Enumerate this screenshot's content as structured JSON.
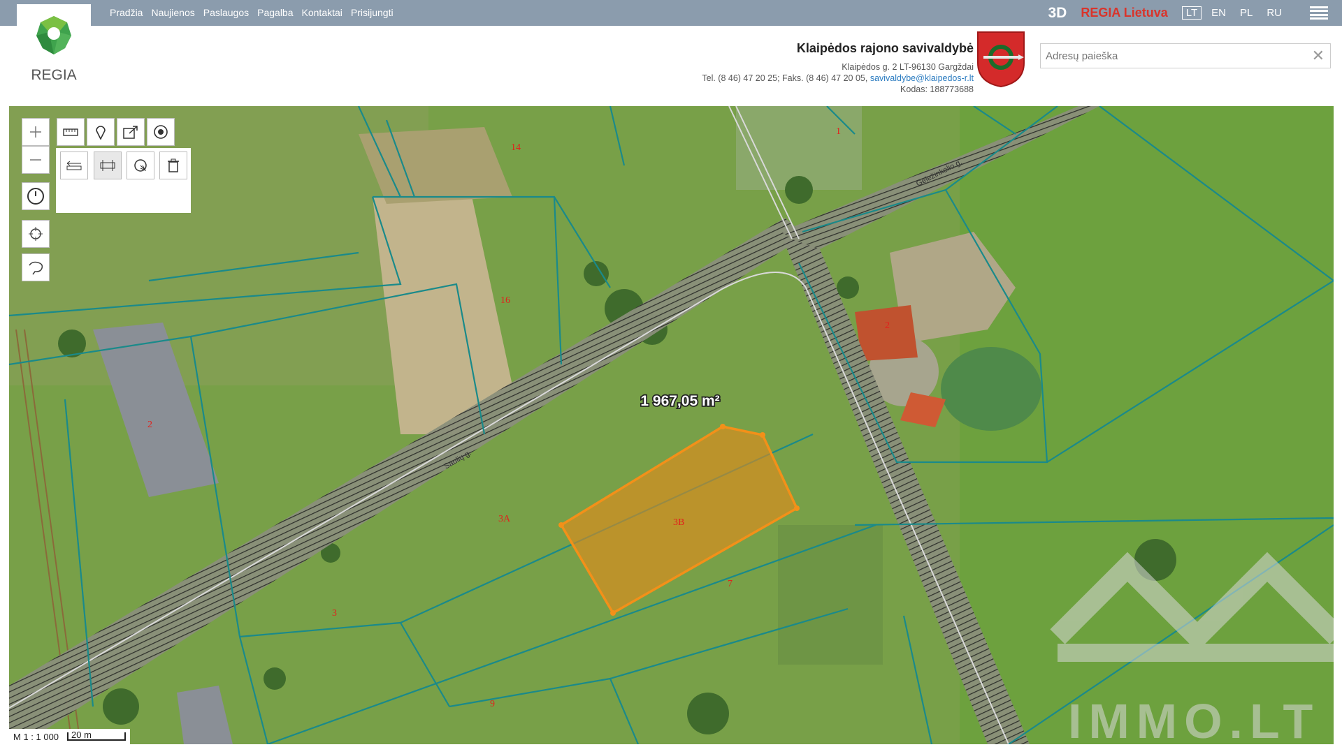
{
  "nav": {
    "items": [
      "Pradžia",
      "Naujienos",
      "Paslaugos",
      "Pagalba",
      "Kontaktai",
      "Prisijungti"
    ]
  },
  "topright": {
    "mode3d": "3D",
    "regia_lt": "REGIA Lietuva",
    "languages": [
      "LT",
      "EN",
      "PL",
      "RU"
    ],
    "active_language": "LT"
  },
  "logo": {
    "text": "REGIA"
  },
  "municipality": {
    "title": "Klaipėdos rajono savivaldybė",
    "address": "Klaipėdos g. 2 LT-96130 Gargždai",
    "phones": "Tel. (8 46) 47 20 25; Faks. (8 46) 47 20 05,",
    "email": "savivaldybe@klaipedos-r.lt",
    "code": "Kodas: 188773688"
  },
  "search": {
    "placeholder": "Adresų paieška",
    "clear": "✕"
  },
  "map": {
    "area_label": "1 967,05 m²",
    "parcels": {
      "p1": "1",
      "p14": "14",
      "p16": "16",
      "p2": "2",
      "p2b": "2",
      "p3B": "3B",
      "p3A": "3A",
      "p3": "3",
      "p7": "7",
      "p9": "9"
    },
    "streets": {
      "s1": "Saulių g.",
      "s2": "Geležinkelio g."
    },
    "scale_ratio": "M 1 : 1 000",
    "scale_len": "20 m",
    "watermark": "IMMO.LT",
    "registered": "®"
  },
  "colors": {
    "topbar": "#8b9cad",
    "parcel_line": "#1a8a8a",
    "selection": "#f08a1c",
    "regia_red": "#d9342b"
  },
  "icons": [
    "plus-icon",
    "minus-icon",
    "clock-icon",
    "crosshair-icon",
    "lasso-icon",
    "ruler-icon",
    "pin-icon",
    "export-icon",
    "target-icon",
    "measure-distance-icon",
    "measure-area-icon",
    "measure-circle-icon",
    "trash-icon"
  ]
}
